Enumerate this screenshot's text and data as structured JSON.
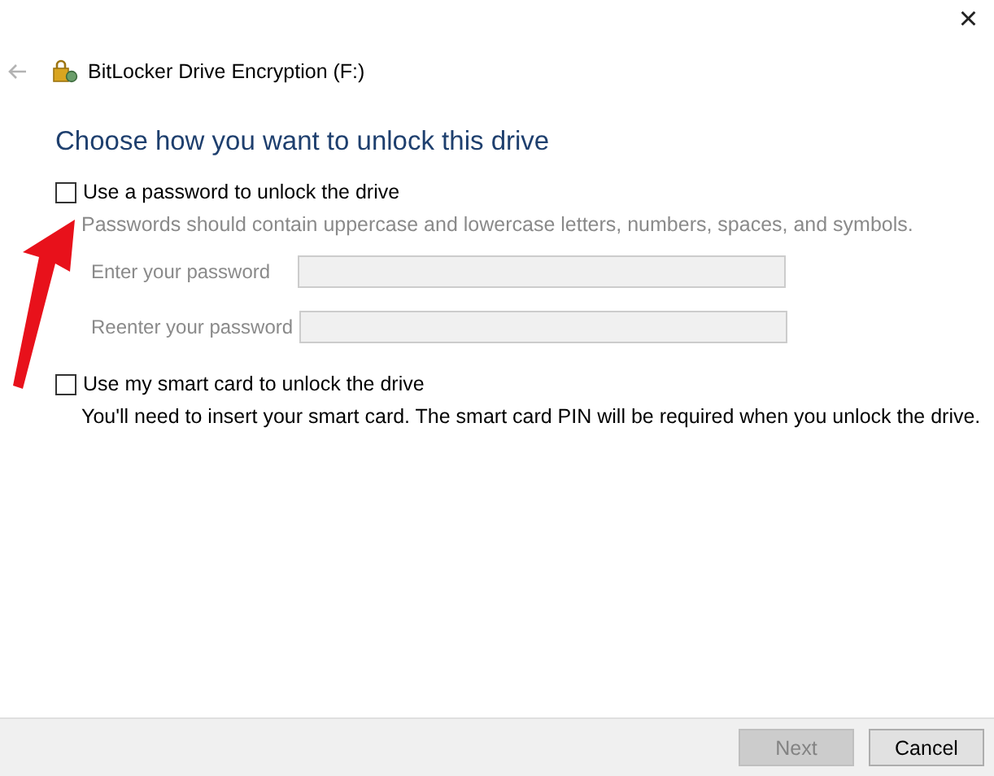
{
  "window": {
    "title": "BitLocker Drive Encryption (F:)",
    "close": "×"
  },
  "heading": "Choose how you want to unlock this drive",
  "options": [
    {
      "label": "Use a password to unlock the drive",
      "checked": false,
      "hint": {
        "text": "Passwords should contain uppercase and lowercase letters, numbers, spaces, and symbols.",
        "disabled": true
      },
      "fields": [
        {
          "label": "Enter your password",
          "disabled": true
        },
        {
          "label": "Reenter your password",
          "disabled": true
        }
      ]
    },
    {
      "label": "Use my smart card to unlock the drive",
      "checked": false,
      "hint": {
        "text": "You'll need to insert your smart card. The smart card PIN will be required when you unlock the drive.",
        "disabled": false
      }
    }
  ],
  "annotation": {
    "kind": "arrow"
  },
  "buttons": [
    {
      "label": "Next",
      "disabled": true
    },
    {
      "label": "Cancel",
      "disabled": false
    }
  ]
}
